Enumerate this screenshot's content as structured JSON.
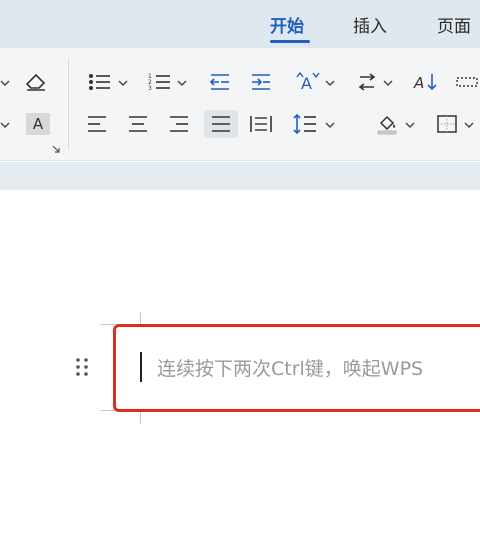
{
  "tabs": [
    {
      "label": "开始",
      "active": true
    },
    {
      "label": "插入",
      "active": false
    },
    {
      "label": "页面",
      "active": false
    }
  ],
  "ribbon": {
    "tools": [
      {
        "name": "eraser-icon"
      },
      {
        "name": "bullet-list-icon"
      },
      {
        "name": "numbered-list-icon"
      },
      {
        "name": "decrease-indent-icon"
      },
      {
        "name": "increase-indent-icon"
      },
      {
        "name": "font-size-icon"
      },
      {
        "name": "text-direction-icon"
      },
      {
        "name": "sort-icon"
      },
      {
        "name": "border-style-icon"
      },
      {
        "name": "character-shading-icon",
        "label": "A"
      },
      {
        "name": "align-left-icon"
      },
      {
        "name": "align-center-icon"
      },
      {
        "name": "align-right-icon"
      },
      {
        "name": "justify-icon",
        "selected": true
      },
      {
        "name": "distributed-icon"
      },
      {
        "name": "line-spacing-icon"
      },
      {
        "name": "shading-icon"
      },
      {
        "name": "border-icon"
      }
    ]
  },
  "document": {
    "placeholder": "连续按下两次Ctrl键，唤起WPS"
  },
  "colors": {
    "accent": "#1f5fbf",
    "highlight_border": "#e02b20",
    "placeholder_text": "#9a9a9a"
  }
}
